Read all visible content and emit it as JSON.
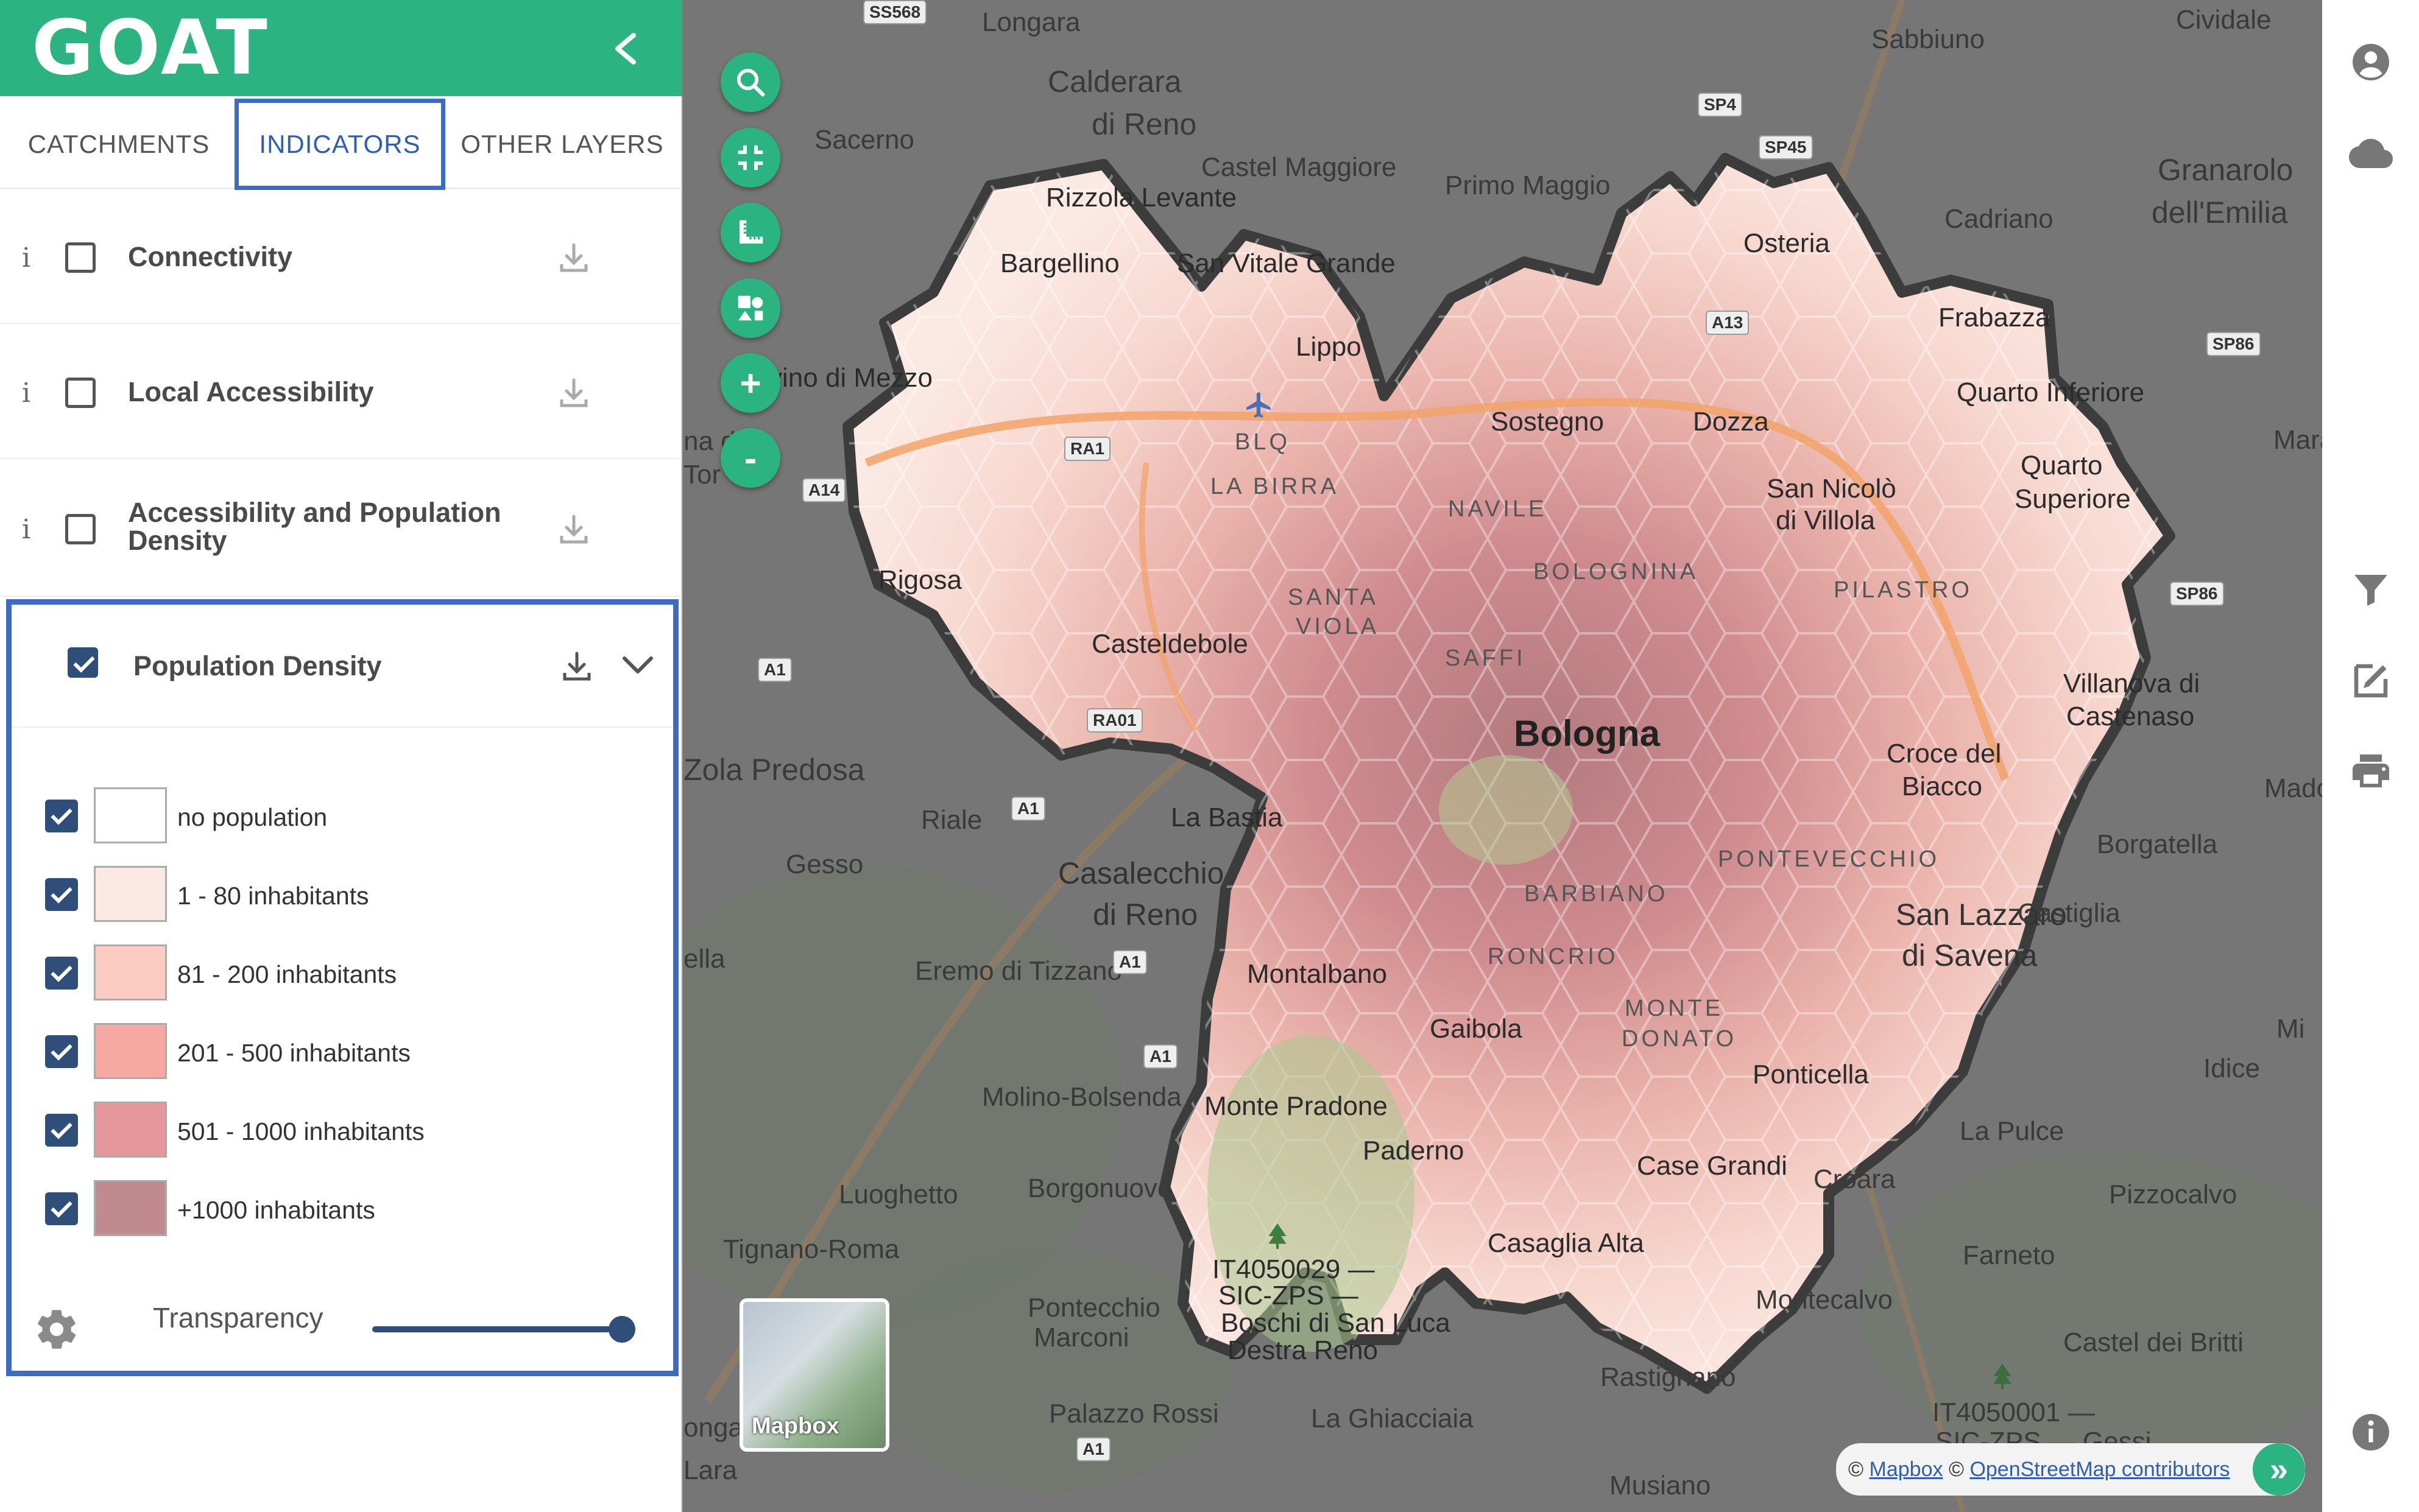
{
  "brand": {
    "logo_text": "GOAT"
  },
  "tabs": [
    {
      "label": "CATCHMENTS"
    },
    {
      "label": "INDICATORS"
    },
    {
      "label": "OTHER LAYERS"
    }
  ],
  "layers": [
    {
      "title": "Connectivity",
      "info": "i"
    },
    {
      "title": "Local Accessibility",
      "info": "i"
    },
    {
      "title_line1": "Accessibility and Population",
      "title_line2": "Density",
      "info": "i"
    },
    {
      "title": "Population Density"
    }
  ],
  "legend": [
    {
      "label": "no population",
      "color": "#ffffff"
    },
    {
      "label": "1 - 80 inhabitants",
      "color": "#fde9e4"
    },
    {
      "label": "81 - 200 inhabitants",
      "color": "#fcccc2"
    },
    {
      "label": "201 - 500 inhabitants",
      "color": "#f6a9a2"
    },
    {
      "label": "501 - 1000 inhabitants",
      "color": "#e5979b"
    },
    {
      "label": "+1000 inhabitants",
      "color": "#c08a8f"
    }
  ],
  "transparency": {
    "label": "Transparency",
    "value_pct": 100
  },
  "map": {
    "labels": [
      "Longara",
      "Sabbiuno",
      "Cividale",
      "Calderara",
      "di Reno",
      "Sacerno",
      "Castel Maggiore",
      "Primo Maggio",
      "Granarolo",
      "dell'Emilia",
      "Rizzola Levante",
      "Osteria",
      "Cadriano",
      "Bargellino",
      "San Vitale Grande",
      "Frabazza",
      "Lippo",
      "vino di Mezzo",
      "Sostegno",
      "Dozza",
      "Quarto Inferiore",
      "BLQ",
      "LA BIRRA",
      "NAVILE",
      "San Nicolò",
      "di Villola",
      "Quarto",
      "Superiore",
      "na d",
      "Tor",
      "BOLOGNINA",
      "SANTA",
      "VIOLA",
      "PILASTRO",
      "Rigosa",
      "Casteldebole",
      "SAFFI",
      "Villanova di",
      "Castenaso",
      "Bologna",
      "Croce del",
      "Biacco",
      "Zola Predosa",
      "La Bastia",
      "Riale",
      "Mado",
      "Gesso",
      "Casalecchio",
      "di Reno",
      "PONTEVECCHIO",
      "Borgatella",
      "BARBIANO",
      "San Lazzaro",
      "di Savena",
      "Castiglia",
      "ella",
      "Eremo di Tizzano",
      "RONCRIO",
      "Montalbano",
      "Gaibola",
      "MONTE",
      "DONATO",
      "Mi",
      "Idice",
      "Ponticella",
      "Molino-Bolsenda",
      "Monte Pradone",
      "La Pulce",
      "Paderno",
      "Luoghetto",
      "Borgonuovo",
      "Case Grandi",
      "Croara",
      "Pizzocalvo",
      "Tignano-Roma",
      "Casaglia Alta",
      "Farneto",
      "IT4050029 —",
      "SIC-ZPS —",
      "Boschi di San Luca",
      "Destra Reno",
      "Pontecchio",
      "Marconi",
      "Montecalvo",
      "Castel dei Britti",
      "Rastignano",
      "Palazzo Rossi",
      "La Ghiacciaia",
      "IT4050001 —",
      "SIC-ZPS — Gessi",
      "Musiano",
      "onga",
      "Lara",
      "Mara"
    ],
    "shields": [
      "SS568",
      "SP4",
      "SP45",
      "A13",
      "SP86",
      "RA1",
      "A14",
      "A1",
      "RA01",
      "A1",
      "A1",
      "A1",
      "A1",
      "SP86"
    ],
    "basemap_label": "Mapbox"
  },
  "attribution": {
    "copy1": "©",
    "link1": "Mapbox",
    "copy2": "©",
    "link2": "OpenStreetMap contributors",
    "expand": "»"
  },
  "colors": {
    "brand_green": "#2bb381",
    "accent_blue": "#3e6bc2",
    "checkbox_blue": "#2f4f7a",
    "boundary": "#3c3c3c"
  }
}
